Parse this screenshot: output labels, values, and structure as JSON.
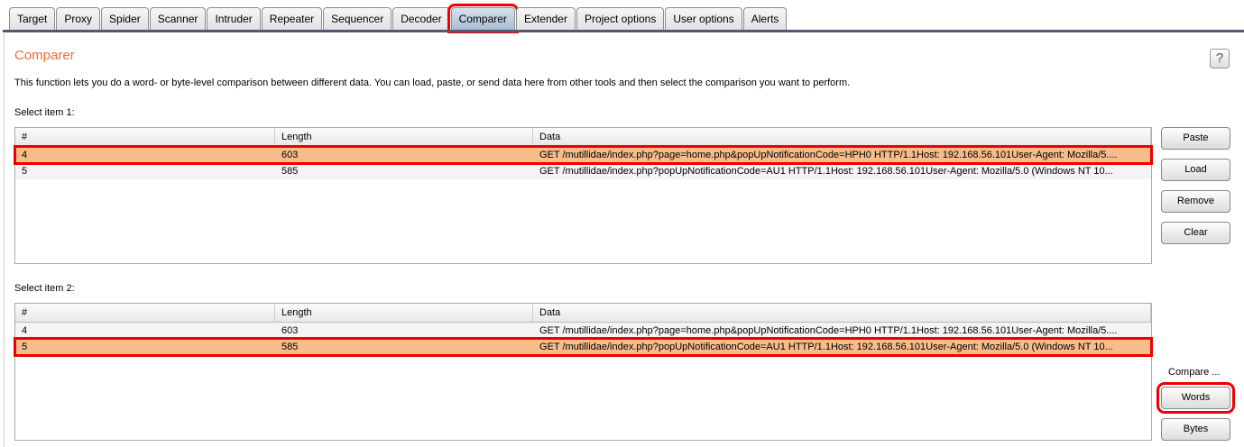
{
  "tabs": [
    "Target",
    "Proxy",
    "Spider",
    "Scanner",
    "Intruder",
    "Repeater",
    "Sequencer",
    "Decoder",
    "Comparer",
    "Extender",
    "Project options",
    "User options",
    "Alerts"
  ],
  "active_tab": "Comparer",
  "title": "Comparer",
  "help": "?",
  "description": "This function lets you do a word- or byte-level comparison between different data. You can load, paste, or send data here from other tools and then select the comparison you want to perform.",
  "item1": {
    "label": "Select item 1:",
    "columns": [
      "#",
      "Length",
      "Data"
    ],
    "rows": [
      [
        "4",
        "603",
        "GET /mutillidae/index.php?page=home.php&popUpNotificationCode=HPH0 HTTP/1.1Host: 192.168.56.101User-Agent: Mozilla/5...."
      ],
      [
        "5",
        "585",
        "GET /mutillidae/index.php?popUpNotificationCode=AU1 HTTP/1.1Host: 192.168.56.101User-Agent: Mozilla/5.0 (Windows NT 10..."
      ]
    ],
    "selected": 0
  },
  "item2": {
    "label": "Select item 2:",
    "columns": [
      "#",
      "Length",
      "Data"
    ],
    "rows": [
      [
        "4",
        "603",
        "GET /mutillidae/index.php?page=home.php&popUpNotificationCode=HPH0 HTTP/1.1Host: 192.168.56.101User-Agent: Mozilla/5...."
      ],
      [
        "5",
        "585",
        "GET /mutillidae/index.php?popUpNotificationCode=AU1 HTTP/1.1Host: 192.168.56.101User-Agent: Mozilla/5.0 (Windows NT 10..."
      ]
    ],
    "selected": 1
  },
  "buttons": {
    "paste": "Paste",
    "load": "Load",
    "remove": "Remove",
    "clear": "Clear"
  },
  "compare": {
    "label": "Compare ...",
    "words": "Words",
    "bytes": "Bytes"
  }
}
